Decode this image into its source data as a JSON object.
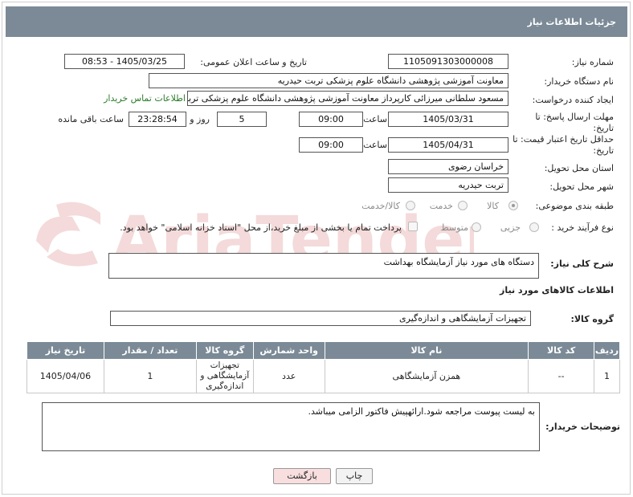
{
  "header": {
    "title": "جزئیات اطلاعات نیاز"
  },
  "form": {
    "need_number_label": "شماره نیاز:",
    "need_number": "1105091303000008",
    "announce_label": "تاریخ و ساعت اعلان عمومی:",
    "announce_value": "1405/03/25 - 08:53",
    "buyer_label": "نام دستگاه خریدار:",
    "buyer_value": "معاونت آموزشی پژوهشی   دانشگاه علوم پزشکی تربت حیدریه",
    "creator_label": "ایجاد کننده درخواست:",
    "creator_value": "مسعود سلطانی میرزائی کارپرداز معاونت آموزشی پژوهشی   دانشگاه علوم پزشکی تربت حیدریه",
    "contact_link": "اطلاعات تماس خریدار",
    "deadline_label": "مهلت ارسال پاسخ: تا تاریخ:",
    "deadline_date": "1405/03/31",
    "time_label": "ساعت",
    "deadline_time": "09:00",
    "days_value": "5",
    "days_label": "روز و",
    "remaining_value": "23:28:54",
    "remaining_label": "ساعت باقی مانده",
    "min_price_label": "حداقل تاریخ اعتبار قیمت: تا تاریخ:",
    "min_price_date": "1405/04/31",
    "min_price_time": "09:00",
    "province_label": "استان محل تحویل:",
    "province_value": "خراسان رضوی",
    "city_label": "شهر محل تحویل:",
    "city_value": "تربت حیدریه",
    "category_label": "طبقه بندی موضوعی:",
    "category_options": [
      "کالا",
      "خدمت",
      "کالا/خدمت"
    ],
    "process_label": "نوع فرآیند خرید :",
    "process_options": [
      "جزیی",
      "متوسط"
    ],
    "payment_note": "پرداخت تمام یا بخشی از مبلغ خرید،از محل \"اسناد خزانه اسلامی\" خواهد بود."
  },
  "description": {
    "label": "شرح کلی نیاز:",
    "value": "دستگاه های مورد نیاز آزمایشگاه بهداشت"
  },
  "goods_section": {
    "title": "اطلاعات کالاهای مورد نیاز"
  },
  "goods_group": {
    "label": "گروه کالا:",
    "value": "تجهیزات آزمایشگاهی و اندازه‌گیری"
  },
  "table": {
    "headers": [
      "ردیف",
      "کد کالا",
      "نام کالا",
      "واحد شمارش",
      "گروه کالا",
      "تعداد / مقدار",
      "تاریخ نیاز"
    ],
    "rows": [
      [
        "1",
        "--",
        "همزن آزمایشگاهی",
        "عدد",
        "تجهیزات آزمایشگاهی و اندازه‌گیری",
        "1",
        "1405/04/06"
      ]
    ]
  },
  "buyer_notes": {
    "label": "توضیحات خریدار:",
    "value": "به لیست پیوست مراجعه شود.ارائهپیش فاکتور الزامی میباشد."
  },
  "buttons": {
    "print": "چاپ",
    "back": "بازگشت"
  },
  "watermark": "AriaTender.net",
  "colors": {
    "header_bg": "#7b8a96",
    "link": "#2a7b2a",
    "back_button_bg": "#f8dede"
  }
}
